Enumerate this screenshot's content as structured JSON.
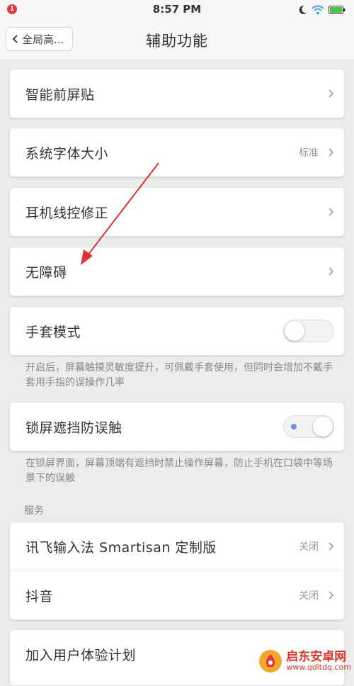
{
  "status_bar": {
    "time": "8:57 PM",
    "notification_count": "1",
    "icons": [
      "moon-icon",
      "wifi-icon",
      "battery-icon"
    ]
  },
  "nav": {
    "back_label": "全局高...",
    "title": "辅助功能"
  },
  "items": {
    "smart_screen": {
      "label": "智能前屏贴"
    },
    "font_size": {
      "label": "系统字体大小",
      "value": "标准"
    },
    "headset": {
      "label": "耳机线控修正"
    },
    "accessibility": {
      "label": "无障碍"
    },
    "glove_mode": {
      "label": "手套模式",
      "enabled": false,
      "note": "开启后，屏幕触摸灵敏度提升，可佩戴手套使用，但同时会增加不戴手套用手指的误操作几率"
    },
    "lock_screen_block": {
      "label": "锁屏遮挡防误触",
      "enabled": true,
      "note": "在锁屏界面，屏幕顶端有遮挡时禁止操作屏幕，防止手机在口袋中等场景下的误触"
    }
  },
  "services": {
    "header": "服务",
    "items": [
      {
        "label": "讯飞输入法 Smartisan 定制版",
        "value": "关闭"
      },
      {
        "label": "抖音",
        "value": "关闭"
      }
    ]
  },
  "experience": {
    "label": "加入用户体验计划"
  },
  "watermark": {
    "title": "启东安卓网",
    "url": "www.qdltdq.com"
  },
  "colors": {
    "accent_arrow": "#e03030",
    "toggle_dot": "#6e8fe6",
    "badge": "#e0393e"
  }
}
